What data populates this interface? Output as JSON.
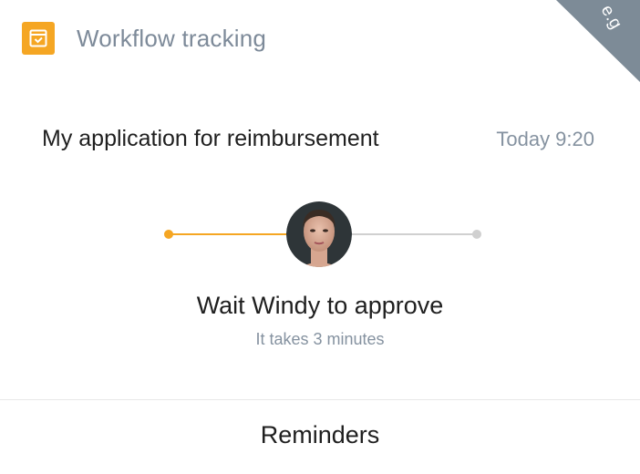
{
  "header": {
    "title": "Workflow tracking",
    "icon": "calendar-check-icon",
    "icon_color": "#f5a623"
  },
  "corner_badge": {
    "text": "e.g",
    "color": "#7d8b97"
  },
  "application": {
    "title": "My application for reimbursement",
    "time": "Today 9:20"
  },
  "progress": {
    "steps": 3,
    "current_step": 2,
    "done_color": "#f5a623",
    "pending_color": "#d0d0d0",
    "current_avatar": "avatar"
  },
  "status": {
    "title": "Wait Windy to approve",
    "subtitle": "It takes 3 minutes"
  },
  "footer": {
    "reminders_label": "Reminders"
  }
}
